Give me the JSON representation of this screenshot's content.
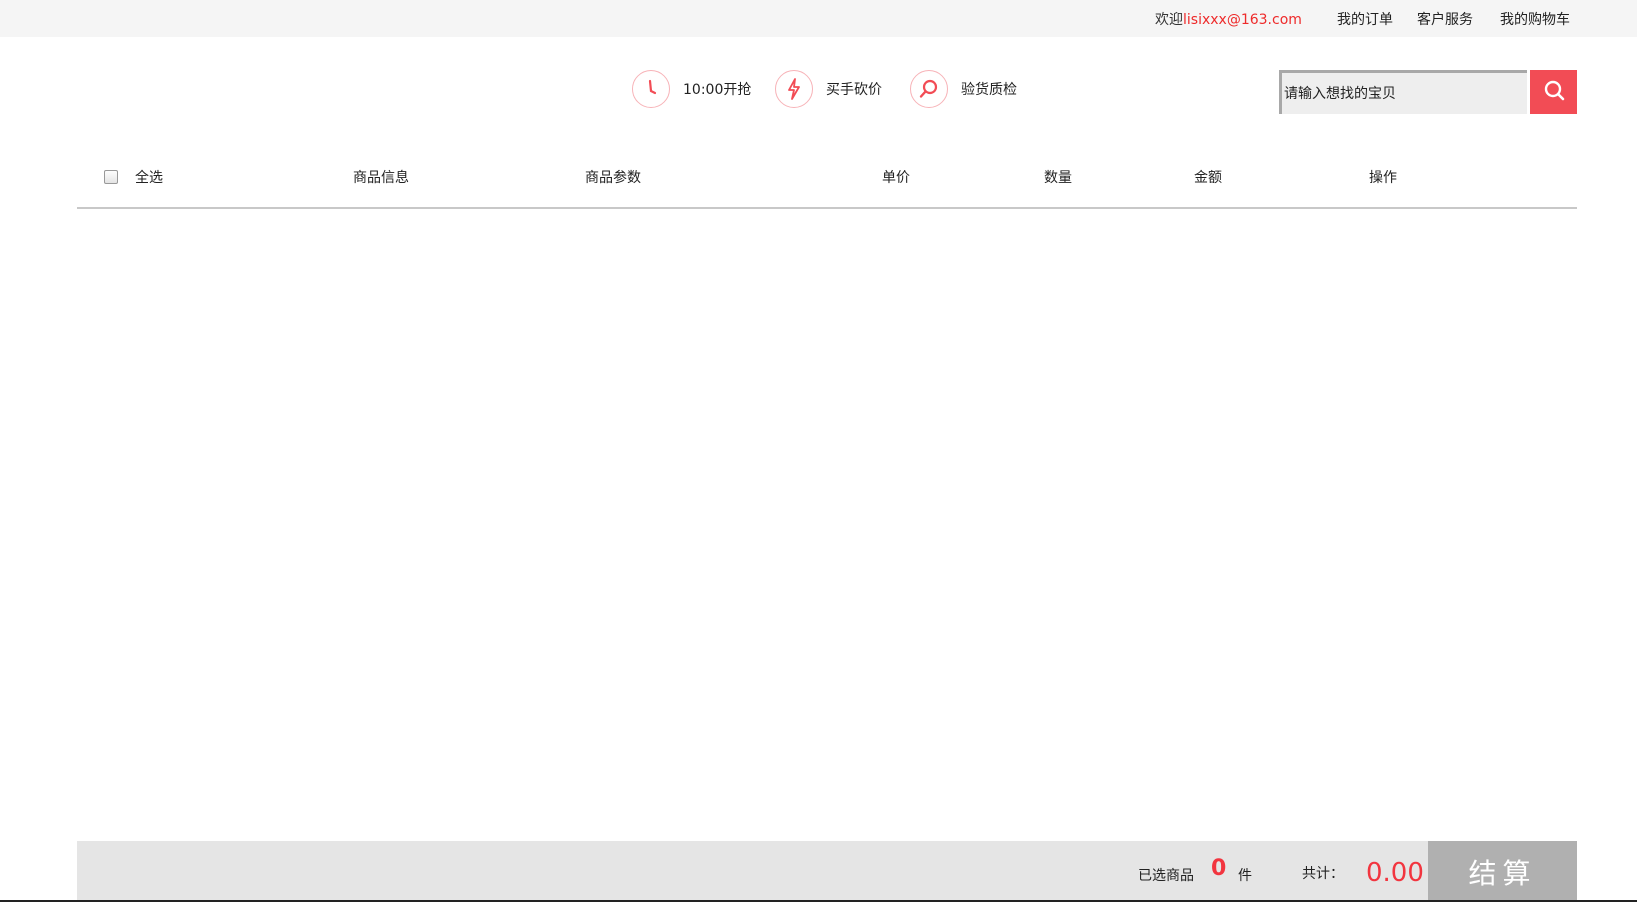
{
  "topbar": {
    "welcome_prefix": "欢迎",
    "email": "lisixxx@163.com",
    "links": [
      "我的订单",
      "客户服务",
      "我的购物车"
    ]
  },
  "features": [
    {
      "icon": "clock-icon",
      "label": "10:00开抢"
    },
    {
      "icon": "lightning-icon",
      "label": "买手砍价"
    },
    {
      "icon": "magnifier-icon",
      "label": "验货质检"
    }
  ],
  "search": {
    "placeholder": "请输入想找的宝贝",
    "button_icon": "search-icon"
  },
  "table": {
    "select_all": "全选",
    "columns": [
      "商品信息",
      "商品参数",
      "单价",
      "数量",
      "金额",
      "操作"
    ]
  },
  "footer": {
    "selected_label": "已选商品",
    "selected_count": "0",
    "selected_unit": "件",
    "total_label": "共计：",
    "total_value": "0.00",
    "checkout_label": "结算"
  },
  "colors": {
    "accent": "#f24c55",
    "price": "#f2353f",
    "email": "#ee2a2a",
    "checkout_bg": "#b0b0b0"
  }
}
